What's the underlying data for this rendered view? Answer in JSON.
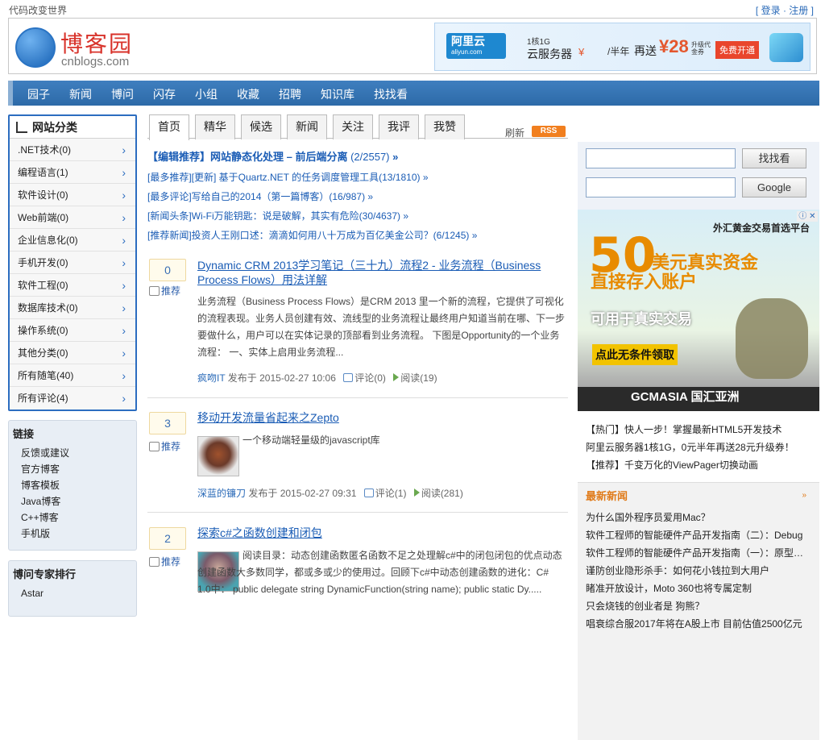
{
  "topbar": {
    "slogan": "代码改变世界",
    "auth_open": "[",
    "login": "登录",
    "dot": "·",
    "register": "注册",
    "auth_close": "]"
  },
  "logo": {
    "brand": "博客园",
    "domain": "cnblogs.com"
  },
  "banner": {
    "vendor": "阿里云",
    "vendor_sub": "aliyun.com",
    "spec": "1核1G",
    "product": "云服务器",
    "yen": "¥",
    "per": "/半年",
    "gift": "再送",
    "amount": "¥28",
    "note": "升级代金券",
    "button": "免费开通"
  },
  "nav": [
    "园子",
    "新闻",
    "博问",
    "闪存",
    "小组",
    "收藏",
    "招聘",
    "知识库",
    "找找看"
  ],
  "categories": {
    "title": "网站分类",
    "items": [
      ".NET技术(0)",
      "编程语言(1)",
      "软件设计(0)",
      "Web前端(0)",
      "企业信息化(0)",
      "手机开发(0)",
      "软件工程(0)",
      "数据库技术(0)",
      "操作系统(0)",
      "其他分类(0)",
      "所有随笔(40)",
      "所有评论(4)"
    ]
  },
  "links": {
    "title": "链接",
    "items": [
      "反馈或建议",
      "官方博客",
      "博客模板",
      "Java博客",
      "C++博客",
      "手机版"
    ]
  },
  "experts": {
    "title": "博问专家排行",
    "items": [
      "Astar"
    ]
  },
  "tabs": {
    "items": [
      "首页",
      "精华",
      "候选",
      "新闻",
      "关注",
      "我评",
      "我赞"
    ],
    "refresh": "刷新",
    "rss": "RSS"
  },
  "editor_pick": {
    "title": "【编辑推荐】网站静态化处理 – 前后端分离",
    "count": "(2/2557)",
    "more": "»"
  },
  "recs": [
    "[最多推荐][更新] 基于Quartz.NET 的任务调度管理工具(13/1810) »",
    "[最多评论]写给自己的2014（第一篇博客）(16/987) »",
    "[新闻头条]Wi-Fi万能钥匙：说是破解，其实有危险(30/4637) »",
    "[推荐新闻]投资人王刚口述：滴滴如何用八十万成为百亿美金公司？(6/1245) »"
  ],
  "posts": [
    {
      "votes": "0",
      "digg": "推荐",
      "title": "Dynamic CRM 2013学习笔记（三十九）流程2 - 业务流程（Business Process Flows）用法详解",
      "summary": "业务流程（Business Process Flows）是CRM 2013 里一个新的流程，它提供了可视化的流程表现。业务人员创建有效、流线型的业务流程让最终用户知道当前在哪、下一步要做什么，用户可以在实体记录的顶部看到业务流程。 下图是Opportunity的一个业务流程： 一、实体上启用业务流程...",
      "author": "疯吻IT",
      "posted": "发布于 2015-02-27 10:06",
      "comments": "评论(0)",
      "reads": "阅读(19)"
    },
    {
      "votes": "3",
      "digg": "推荐",
      "title": "移动开发流量省起来之Zepto",
      "summary": "一个移动端轻量级的javascript库",
      "author": "深蓝的镰刀",
      "posted": "发布于 2015-02-27 09:31",
      "comments": "评论(1)",
      "reads": "阅读(281)"
    },
    {
      "votes": "2",
      "digg": "推荐",
      "title": "探索c#之函数创建和闭包",
      "summary": "阅读目录：动态创建函数匿名函数不足之处理解c#中的闭包闭包的优点动态创建函数大多数同学，都或多或少的使用过。回顾下c#中动态创建函数的进化：C# 1.0中： public delegate string DynamicFunction(string name); public static Dy.....",
      "author": "",
      "posted": "",
      "comments": "",
      "reads": ""
    }
  ],
  "search": {
    "btn1": "找找看",
    "btn2": "Google"
  },
  "ad": {
    "top": "外汇黄金交易首选平台",
    "big": "50",
    "line1": "美元真实资金",
    "line2": "直接存入账户",
    "line3": "可用于真实交易",
    "cta": "点此无条件领取",
    "bottom": "GCMASIA 国汇亚洲",
    "close": "ⓘ ✕"
  },
  "hot": [
    "【热门】快人一步！掌握最新HTML5开发技术",
    "阿里云服务器1核1G，0元半年再送28元升级券！",
    "【推荐】千变万化的ViewPager切换动画"
  ],
  "news": {
    "title": "最新新闻",
    "more": "»",
    "items": [
      "为什么国外程序员爱用Mac？",
      "软件工程师的智能硬件产品开发指南（二）：Debug",
      "软件工程师的智能硬件产品开发指南（一）：原型…",
      "谨防创业隐形杀手：如何花小钱拉到大用户",
      "睹准开放设计，Moto 360也将专属定制",
      "只会烧钱的创业者是 狗熊？",
      "唱衰综合服2017年将在A股上市 目前估值2500亿元"
    ]
  }
}
